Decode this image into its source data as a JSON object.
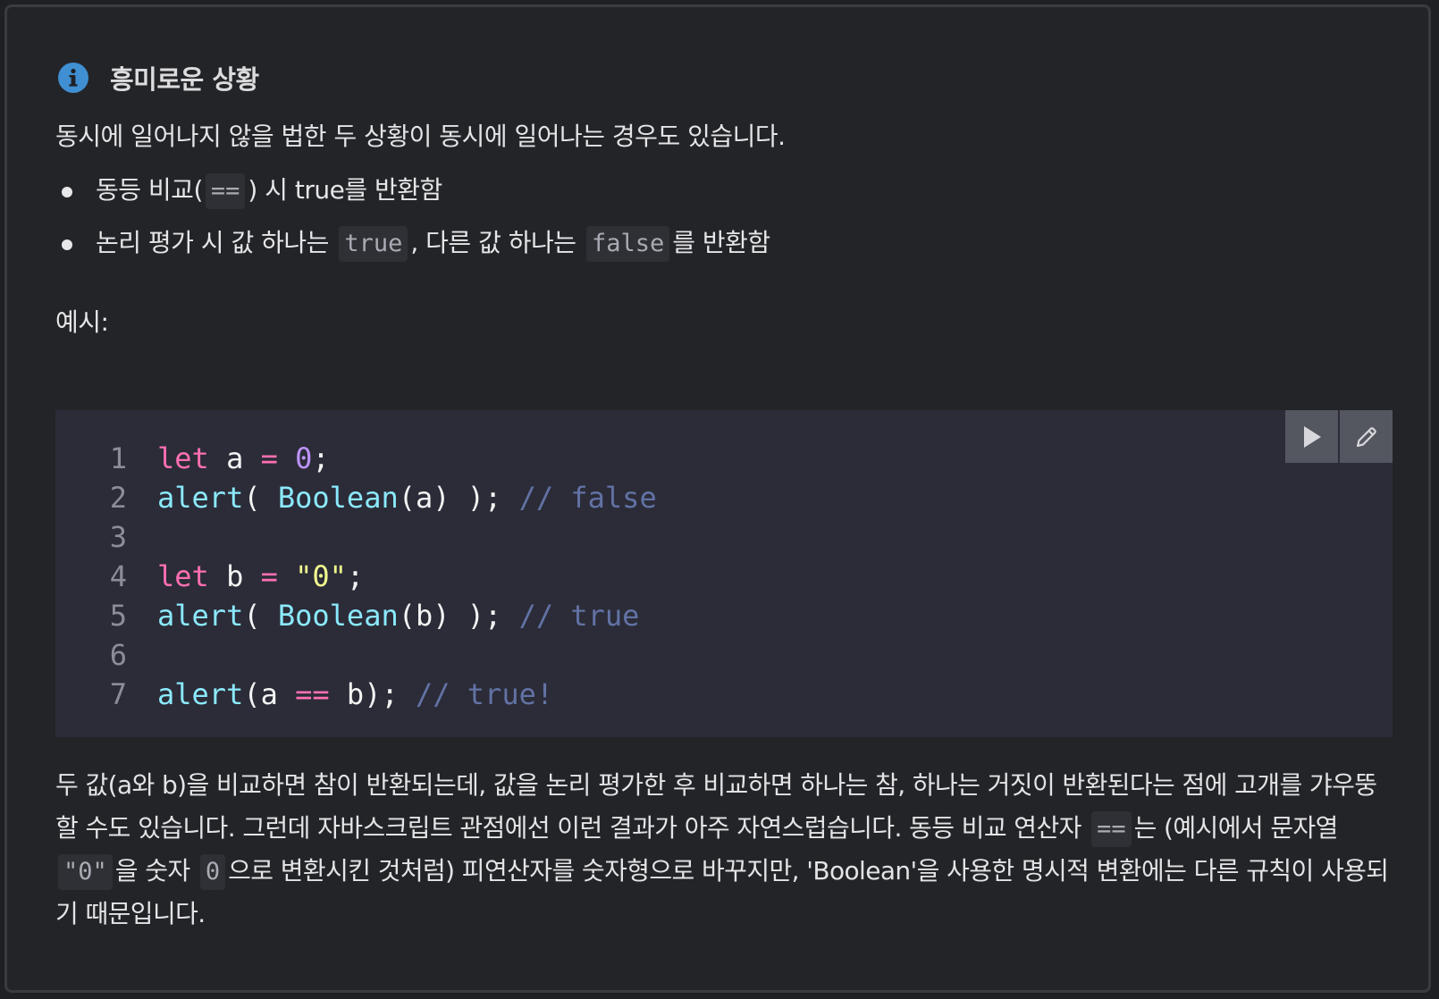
{
  "note": {
    "title": "흥미로운 상황",
    "intro": "동시에 일어나지 않을 법한 두 상황이 동시에 일어나는 경우도 있습니다.",
    "points": [
      {
        "before": "동등 비교(",
        "code": "==",
        "after": ") 시 true를 반환함"
      },
      {
        "before": "논리 평가 시 값 하나는 ",
        "code": "true",
        "middle": ", 다른 값 하나는 ",
        "code2": "false",
        "after": "를 반환함"
      }
    ],
    "example_label": "예시:",
    "outro": {
      "p1": "두 값(a와 b)을 비교하면 참이 반환되는데, 값을 논리 평가한 후 비교하면 하나는 참, 하나는 거짓이 반환된다는 점에 고개를 갸우뚱할 수도 있습니다. 그런데 자바스크립트 관점에선 이런 결과가 아주 자연스럽습니다. 동등 비교 연산자 ",
      "c1": "==",
      "p2": "는 (예시에서 문자열 ",
      "c2": "\"0\"",
      "p3": "을 숫자 ",
      "c3": "0",
      "p4": "으로 변환시킨 것처럼) 피연산자를 숫자형으로 바꾸지만, 'Boolean'을 사용한 명시적 변환에는 다른 규칙이 사용되기 때문입니다."
    }
  },
  "code": {
    "run_icon": "play-icon",
    "edit_icon": "pencil-icon",
    "lines": [
      {
        "n": "1",
        "tokens": [
          {
            "t": "let",
            "k": "kw"
          },
          {
            "t": " a ",
            "k": "pl"
          },
          {
            "t": "=",
            "k": "op"
          },
          {
            "t": " ",
            "k": "pl"
          },
          {
            "t": "0",
            "k": "num"
          },
          {
            "t": ";",
            "k": "pl"
          }
        ]
      },
      {
        "n": "2",
        "tokens": [
          {
            "t": "alert",
            "k": "fn"
          },
          {
            "t": "( ",
            "k": "pl"
          },
          {
            "t": "Boolean",
            "k": "fn"
          },
          {
            "t": "(a) ); ",
            "k": "pl"
          },
          {
            "t": "// false",
            "k": "cm"
          }
        ]
      },
      {
        "n": "3",
        "tokens": []
      },
      {
        "n": "4",
        "tokens": [
          {
            "t": "let",
            "k": "kw"
          },
          {
            "t": " b ",
            "k": "pl"
          },
          {
            "t": "=",
            "k": "op"
          },
          {
            "t": " ",
            "k": "pl"
          },
          {
            "t": "\"0\"",
            "k": "str"
          },
          {
            "t": ";",
            "k": "pl"
          }
        ]
      },
      {
        "n": "5",
        "tokens": [
          {
            "t": "alert",
            "k": "fn"
          },
          {
            "t": "( ",
            "k": "pl"
          },
          {
            "t": "Boolean",
            "k": "fn"
          },
          {
            "t": "(b) ); ",
            "k": "pl"
          },
          {
            "t": "// true",
            "k": "cm"
          }
        ]
      },
      {
        "n": "6",
        "tokens": []
      },
      {
        "n": "7",
        "tokens": [
          {
            "t": "alert",
            "k": "fn"
          },
          {
            "t": "(a ",
            "k": "pl"
          },
          {
            "t": "==",
            "k": "op"
          },
          {
            "t": " b); ",
            "k": "pl"
          },
          {
            "t": "// true!",
            "k": "cm"
          }
        ]
      }
    ]
  },
  "colors": {
    "info_icon": "#3f8fd2",
    "keyword": "#ff6fb2",
    "number": "#bd93f9",
    "string": "#f1fa8c",
    "function": "#8be9fd",
    "comment": "#6272a4"
  }
}
